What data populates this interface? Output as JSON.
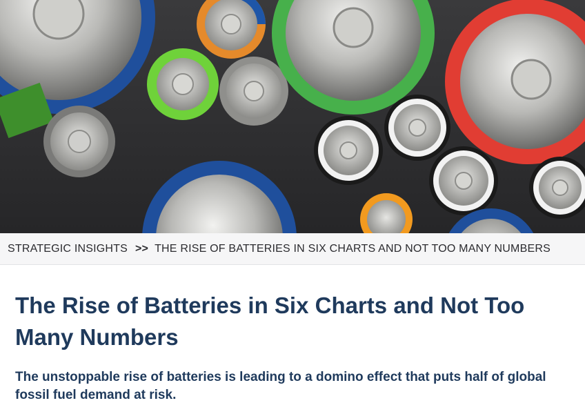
{
  "hero": {
    "image": "assorted-batteries-photo"
  },
  "breadcrumb": {
    "section": "STRATEGIC INSIGHTS",
    "separator": ">>",
    "current": "THE RISE OF BATTERIES IN SIX CHARTS AND NOT TOO MANY NUMBERS"
  },
  "article": {
    "title": "The Rise of Batteries in Six Charts and Not Too Many Numbers",
    "subtitle": "The unstoppable rise of batteries is leading to a domino effect that puts half of global fossil fuel demand at risk."
  },
  "colors": {
    "heading": "#1f3a5c",
    "breadcrumb_bg": "#f5f5f6",
    "breadcrumb_text": "#2b2b2f"
  }
}
